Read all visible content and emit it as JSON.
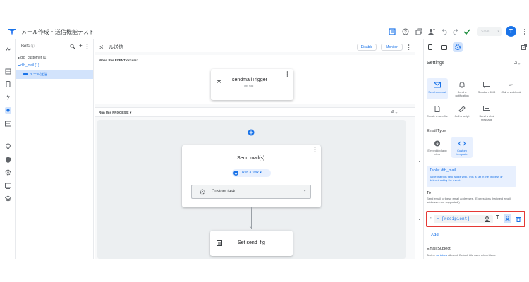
{
  "app": {
    "title": "メール作成・送信機能テスト",
    "save_label": "Save",
    "avatar_letter": "T"
  },
  "bots": {
    "title": "Bots",
    "items": [
      {
        "label": "dtb_customer (1)"
      },
      {
        "label": "dtb_mail (1)"
      },
      {
        "label": "メール送信"
      }
    ]
  },
  "main": {
    "title": "メール送信",
    "disable_label": "Disable",
    "monitor_label": "Monitor",
    "event_header": "When this EVENT occurs:",
    "trigger_name": "sendmailTrigger",
    "trigger_table": "dtb_mail",
    "process_header": "Run this PROCESS:",
    "step1_title": "Send mail(s)",
    "run_task_label": "Run a task",
    "custom_task_label": "Custom task",
    "step2_title": "Set send_flg"
  },
  "settings": {
    "title": "Settings",
    "actions": [
      {
        "label": "Send an email",
        "icon": "mail-icon",
        "selected": true
      },
      {
        "label": "Send a notification",
        "icon": "bell-icon",
        "selected": false
      },
      {
        "label": "Send an SMS",
        "icon": "sms-icon",
        "selected": false
      },
      {
        "label": "Call a webhook",
        "icon": "api-icon",
        "selected": false
      },
      {
        "label": "Create a new file",
        "icon": "file-icon",
        "selected": false
      },
      {
        "label": "Call a script",
        "icon": "script-icon",
        "selected": false
      },
      {
        "label": "Send a chat message",
        "icon": "chat-icon",
        "selected": false
      }
    ],
    "email_type_label": "Email Type",
    "email_types": [
      {
        "label": "Embedded app view",
        "selected": false
      },
      {
        "label": "Custom template",
        "selected": true
      }
    ],
    "table_label": "Table: dtb_mail",
    "table_desc": "Table that this task works with. This is set in the process or determined by the event.",
    "to_label": "To",
    "to_desc": "Send email to these email addresses. (Expressions that yield email addresses are supported.)",
    "to_value": "= [recipient]",
    "add_label": "Add",
    "subject_label": "Email Subject",
    "subject_desc_prefix": "Text or",
    "subject_desc_link": "variables",
    "subject_desc_suffix": "allowed. Default title used when blank."
  },
  "colors": {
    "accent": "#1a73e8",
    "highlight_border": "#e53935",
    "selected_bg": "#e8f0fe"
  }
}
